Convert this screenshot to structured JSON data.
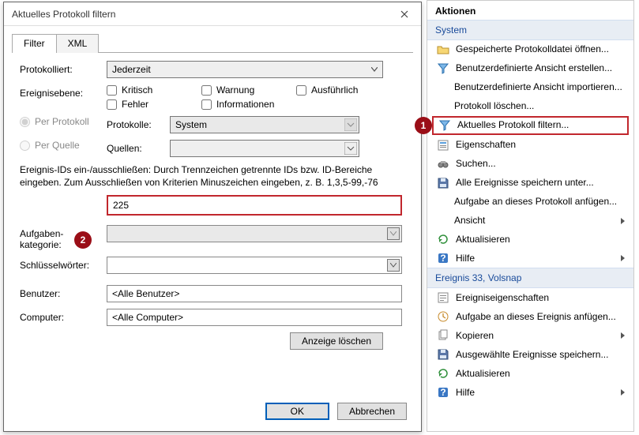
{
  "dialog": {
    "title": "Aktuelles Protokoll filtern",
    "tabs": {
      "filter": "Filter",
      "xml": "XML"
    },
    "labels": {
      "protokolliert": "Protokolliert:",
      "ereignisebene": "Ereignisebene:",
      "per_protokoll": "Per Protokoll",
      "per_quelle": "Per Quelle",
      "protokolle": "Protokolle:",
      "quellen": "Quellen:",
      "aufgabenkategorie": "Aufgaben-\nkategorie:",
      "schluesselwoerter": "Schlüsselwörter:",
      "benutzer": "Benutzer:",
      "computer": "Computer:"
    },
    "values": {
      "protokolliert": "Jederzeit",
      "protokolle": "System",
      "event_id": "225",
      "benutzer": "<Alle Benutzer>",
      "computer": "<Alle Computer>"
    },
    "checkboxes": {
      "kritisch": "Kritisch",
      "warnung": "Warnung",
      "ausfuehrlich": "Ausführlich",
      "fehler": "Fehler",
      "informationen": "Informationen"
    },
    "help_text": "Ereignis-IDs ein-/ausschließen: Durch Trennzeichen getrennte IDs bzw. ID-Bereiche eingeben. Zum Ausschließen von Kriterien Minuszeichen eingeben, z. B. 1,3,5-99,-76",
    "buttons": {
      "clear": "Anzeige löschen",
      "ok": "OK",
      "cancel": "Abbrechen"
    }
  },
  "pane": {
    "title": "Aktionen",
    "group_system": "System",
    "group_event": "Ereignis 33, Volsnap",
    "system_items": {
      "open_saved": "Gespeicherte Protokolldatei öffnen...",
      "create_view": "Benutzerdefinierte Ansicht erstellen...",
      "import_view": "Benutzerdefinierte Ansicht importieren...",
      "clear_log": "Protokoll löschen...",
      "filter_current": "Aktuelles Protokoll filtern...",
      "properties": "Eigenschaften",
      "find": "Suchen...",
      "save_all": "Alle Ereignisse speichern unter...",
      "attach_task_log": "Aufgabe an dieses Protokoll anfügen...",
      "view": "Ansicht",
      "refresh": "Aktualisieren",
      "help": "Hilfe"
    },
    "event_items": {
      "event_props": "Ereigniseigenschaften",
      "attach_task_evt": "Aufgabe an dieses Ereignis anfügen...",
      "copy": "Kopieren",
      "save_selected": "Ausgewählte Ereignisse speichern...",
      "refresh": "Aktualisieren",
      "help": "Hilfe"
    }
  },
  "callouts": {
    "one": "1",
    "two": "2"
  }
}
